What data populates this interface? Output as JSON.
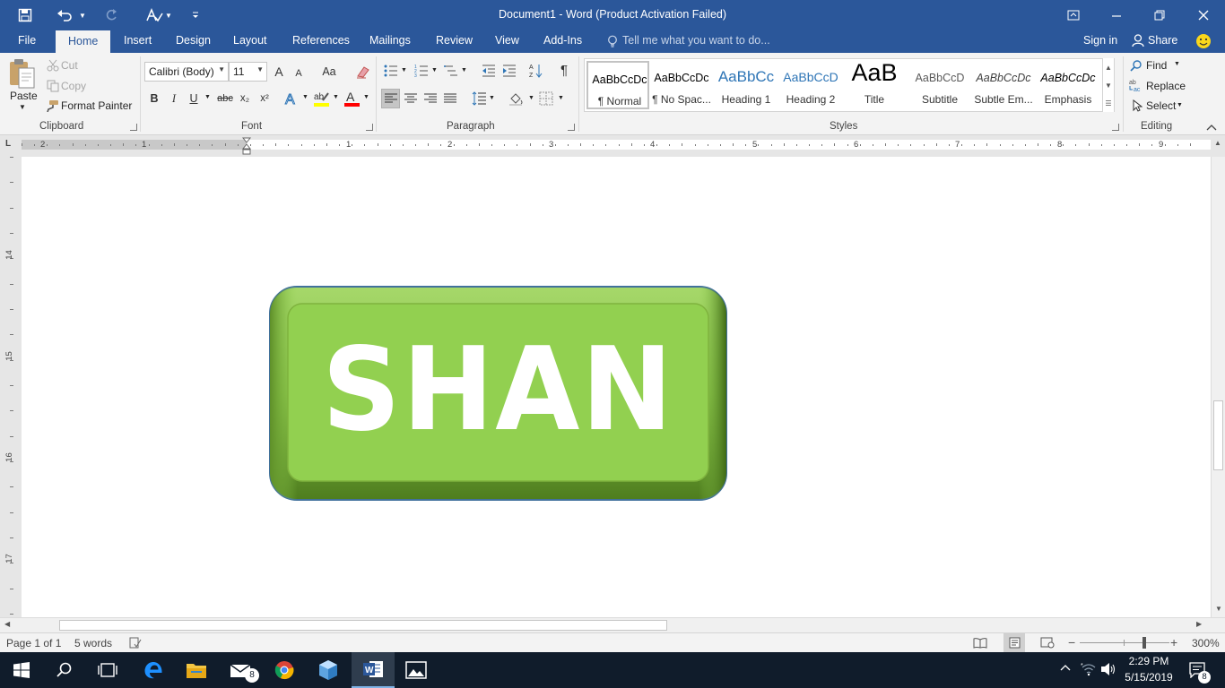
{
  "window": {
    "title": "Document1 - Word (Product Activation Failed)"
  },
  "tabs": [
    "File",
    "Home",
    "Insert",
    "Design",
    "Layout",
    "References",
    "Mailings",
    "Review",
    "View",
    "Add-Ins"
  ],
  "active_tab": "Home",
  "tell_me": "Tell me what you want to do...",
  "account": {
    "sign_in": "Sign in",
    "share": "Share"
  },
  "clipboard": {
    "paste": "Paste",
    "cut": "Cut",
    "copy": "Copy",
    "format_painter": "Format Painter",
    "label": "Clipboard"
  },
  "font": {
    "family": "Calibri (Body)",
    "size": "11",
    "label": "Font",
    "bold": "B",
    "italic": "I",
    "underline": "U",
    "strikethrough": "abc",
    "subscript": "x₂",
    "superscript": "x²",
    "grow": "A",
    "shrink": "A",
    "change_case": "Aa",
    "highlight_color": "#ffff00",
    "font_color": "#ff0000"
  },
  "paragraph": {
    "label": "Paragraph",
    "show_marks": "¶"
  },
  "styles": {
    "label": "Styles",
    "items": [
      {
        "preview": "AaBbCcDc",
        "name": "¶ Normal",
        "selected": true
      },
      {
        "preview": "AaBbCcDc",
        "name": "¶ No Spac..."
      },
      {
        "preview": "AaBbCc",
        "name": "Heading 1"
      },
      {
        "preview": "AaBbCcD",
        "name": "Heading 2"
      },
      {
        "preview": "AaB",
        "name": "Title"
      },
      {
        "preview": "AaBbCcD",
        "name": "Subtitle"
      },
      {
        "preview": "AaBbCcDc",
        "name": "Subtle Em..."
      },
      {
        "preview": "AaBbCcDc",
        "name": "Emphasis"
      }
    ]
  },
  "editing": {
    "label": "Editing",
    "find": "Find",
    "replace": "Replace",
    "select": "Select"
  },
  "ruler": {
    "h_numbers": [
      "2",
      "1",
      "1",
      "2",
      "3",
      "4",
      "5",
      "6",
      "7",
      "8",
      "9"
    ],
    "v_numbers": [
      "14",
      "15",
      "16",
      "17"
    ],
    "tab_marker": "L"
  },
  "document": {
    "shape_text": "SHAN",
    "shape_fill": "#92d050",
    "shape_border": "#41719c"
  },
  "status": {
    "page": "Page 1 of 1",
    "words": "5 words",
    "zoom": "300%"
  },
  "taskbar": {
    "time": "2:29 PM",
    "date": "5/15/2019",
    "mail_badge": "8",
    "notify_badge": "8"
  }
}
